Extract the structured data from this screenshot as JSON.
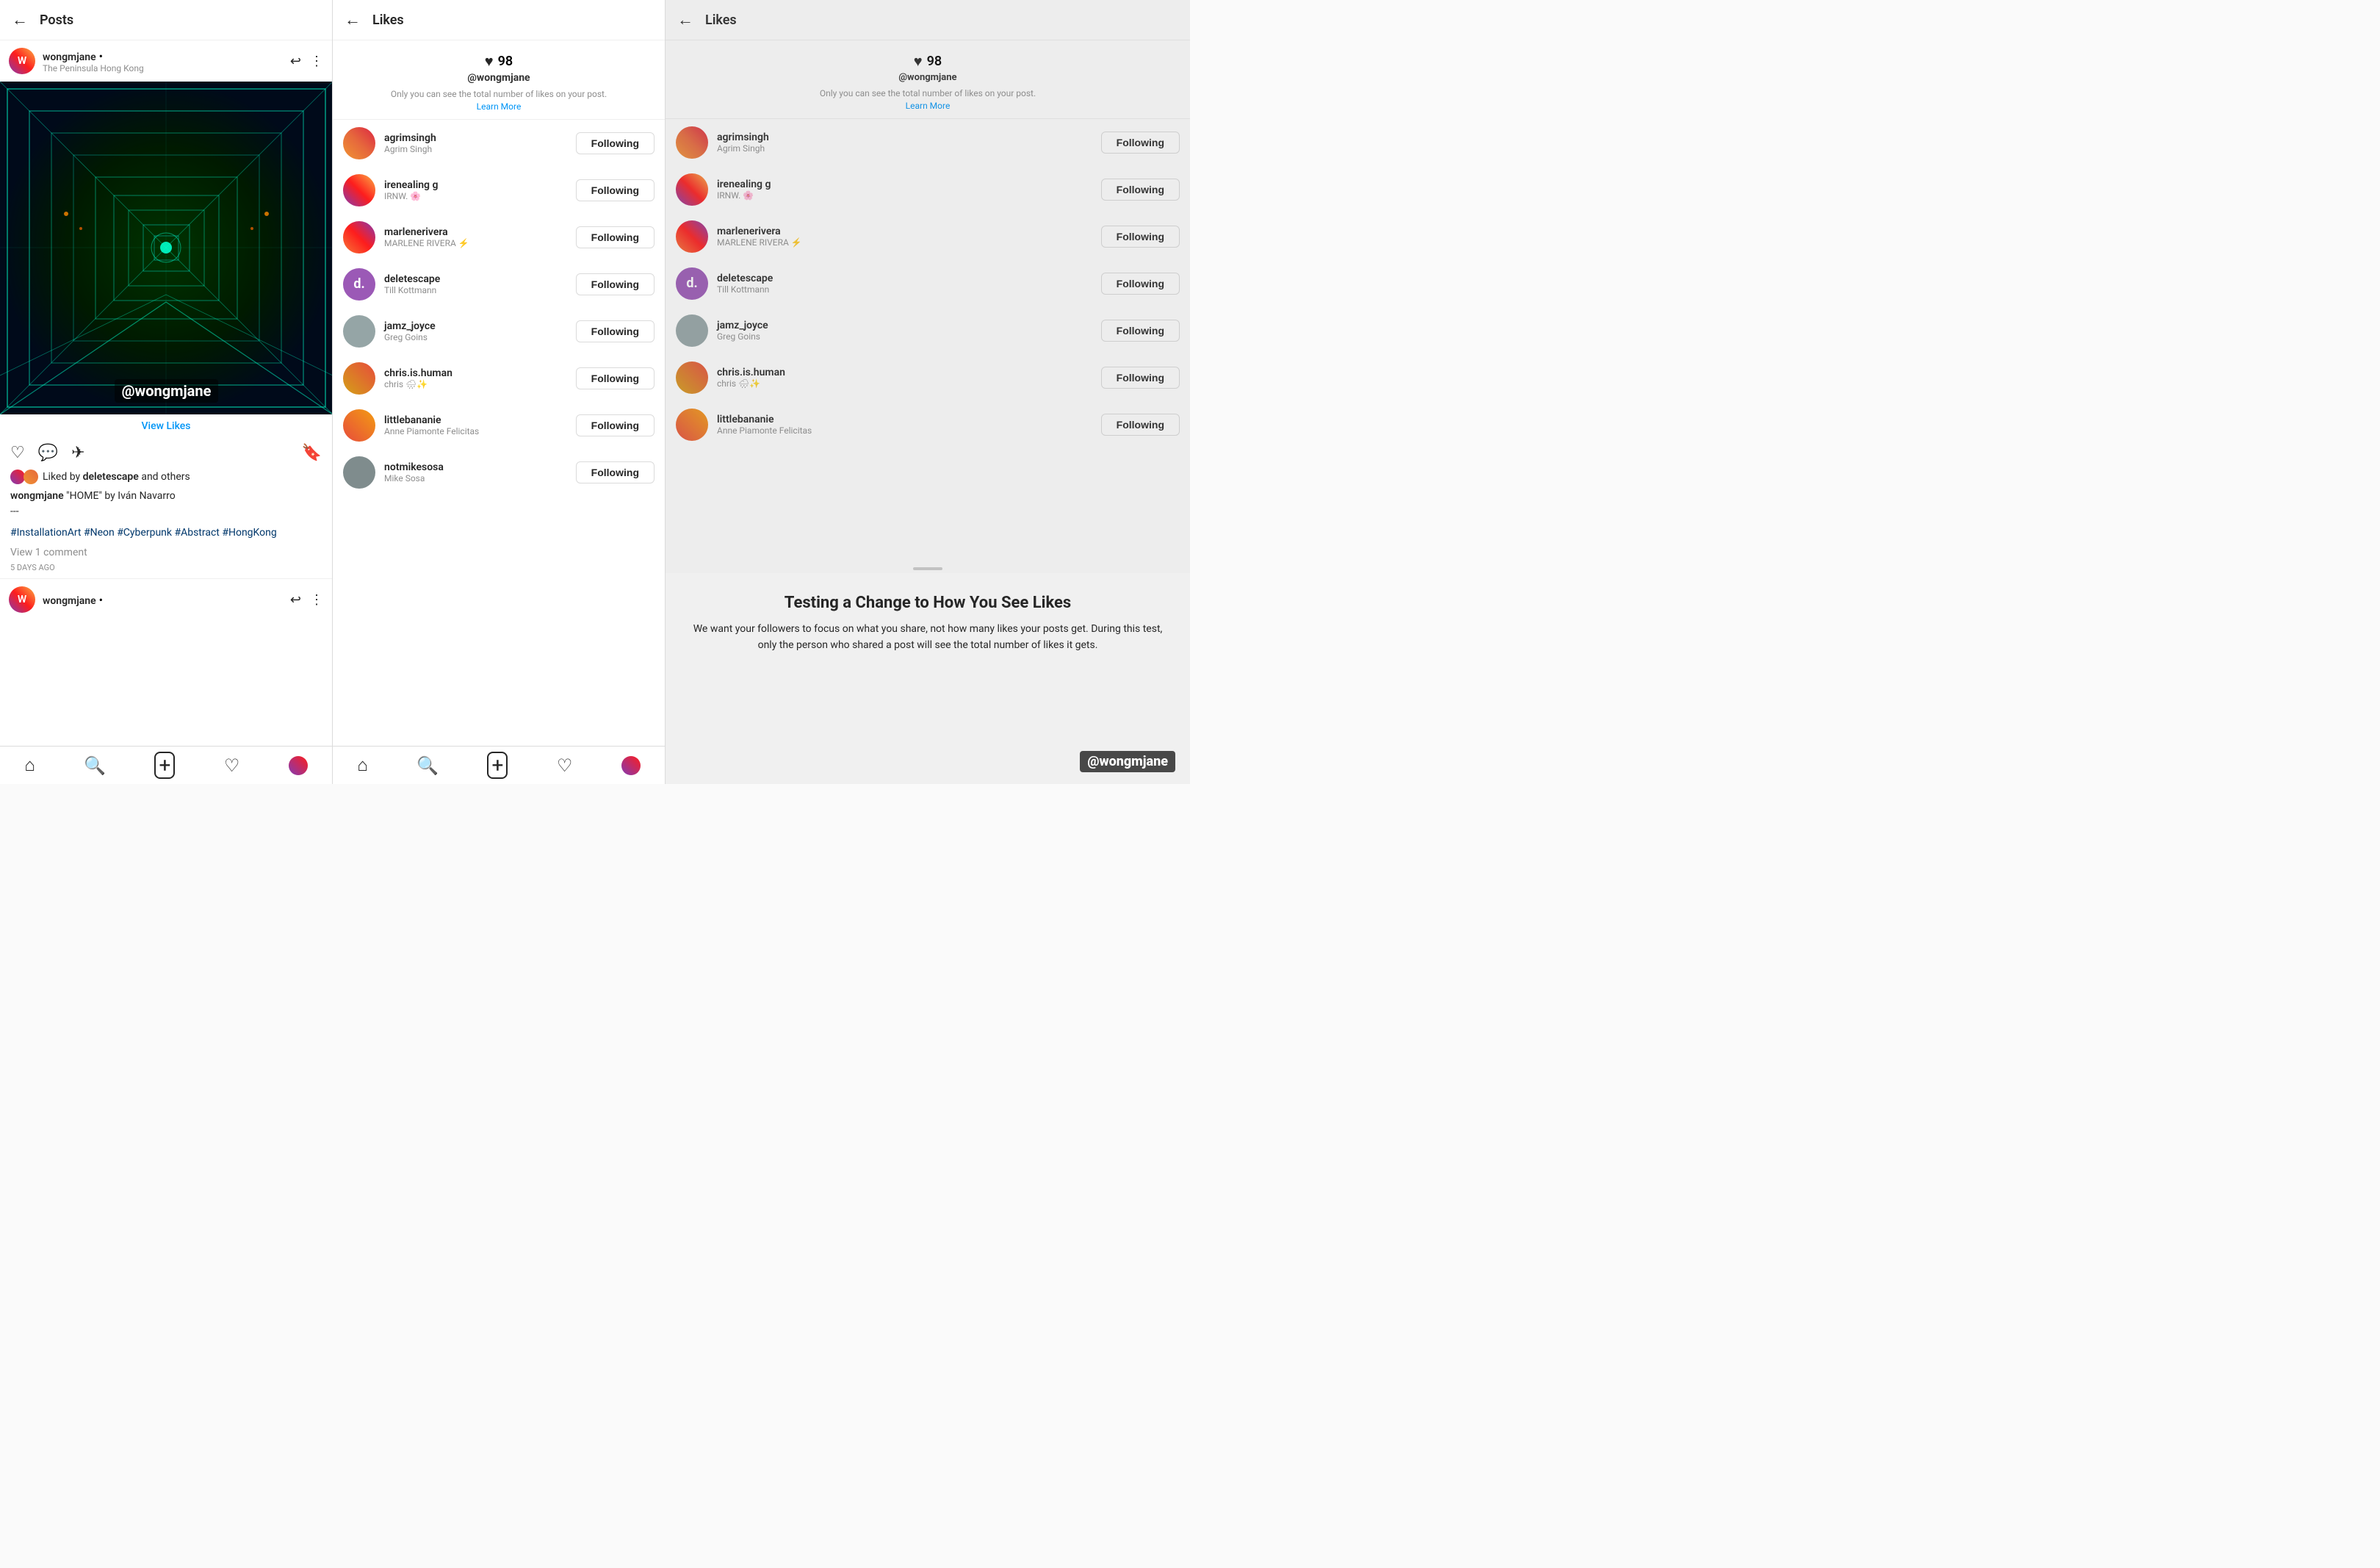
{
  "panel1": {
    "header": {
      "back_label": "←",
      "title": "Posts"
    },
    "post": {
      "username": "wongmjane",
      "dot": "•",
      "location": "The Peninsula Hong Kong",
      "watermark": "@wongmjane",
      "view_likes": "View Likes",
      "liked_by_prefix": "Liked by",
      "liked_by_user": "deletescape",
      "liked_by_suffix": "and others",
      "caption_user": "wongmjane",
      "caption_text": "\"HOME\" by Iván Navarro",
      "caption_dash": "---",
      "hashtags": "#InstallationArt #Neon #Cyberpunk #Abstract #HongKong",
      "comments": "View 1 comment",
      "time": "5 days ago"
    },
    "nav": {
      "home": "⌂",
      "search": "🔍",
      "add": "＋",
      "heart": "♡",
      "profile": "👤"
    }
  },
  "panel2": {
    "header": {
      "back_label": "←",
      "title": "Likes"
    },
    "likes_count": "98",
    "notice": "Only you can see the total number of likes on your post.",
    "learn_more": "Learn More",
    "watermark": "@wongmjane",
    "users": [
      {
        "handle": "agrimsingh",
        "fullname": "Agrim Singh",
        "button": "Following",
        "av_class": "av-agrim",
        "letter": ""
      },
      {
        "handle": "irenealing g",
        "fullname": "IRNW. 🌸",
        "button": "Following",
        "av_class": "av-irene",
        "letter": ""
      },
      {
        "handle": "marlenerivera",
        "fullname": "MARLENE RIVERA ⚡",
        "button": "Following",
        "av_class": "av-marlene",
        "letter": ""
      },
      {
        "handle": "deletescape",
        "fullname": "Till Kottmann",
        "button": "Following",
        "av_class": "av-delete",
        "letter": "d."
      },
      {
        "handle": "jamz_joyce",
        "fullname": "Greg Goins",
        "button": "Following",
        "av_class": "av-jamz",
        "letter": ""
      },
      {
        "handle": "chris.is.human",
        "fullname": "chris 🌧✨",
        "button": "Following",
        "av_class": "av-chris",
        "letter": ""
      },
      {
        "handle": "littlebananie",
        "fullname": "Anne Piamonte Felicitas",
        "button": "Following",
        "av_class": "av-little",
        "letter": ""
      },
      {
        "handle": "notmikesosa",
        "fullname": "Mike Sosa",
        "button": "Following",
        "av_class": "av-notmike",
        "letter": ""
      }
    ]
  },
  "panel3": {
    "header": {
      "back_label": "←",
      "title": "Likes"
    },
    "likes_count": "98",
    "notice": "Only you can see the total number of likes on your post.",
    "learn_more": "Learn More",
    "watermark": "@wongmjane",
    "users": [
      {
        "handle": "agrimsingh",
        "fullname": "Agrim Singh",
        "button": "Following",
        "av_class": "av-agrim"
      },
      {
        "handle": "irenealing g",
        "fullname": "IRNW. 🌸",
        "button": "Following",
        "av_class": "av-irene"
      },
      {
        "handle": "marlenerivera",
        "fullname": "MARLENE RIVERA ⚡",
        "button": "Following",
        "av_class": "av-marlene"
      },
      {
        "handle": "deletescape",
        "fullname": "Till Kottmann",
        "button": "Following",
        "av_class": "av-delete",
        "letter": "d."
      },
      {
        "handle": "jamz_joyce",
        "fullname": "Greg Goins",
        "button": "Following",
        "av_class": "av-jamz"
      },
      {
        "handle": "chris.is.human",
        "fullname": "chris 🌧✨",
        "button": "Following",
        "av_class": "av-chris"
      },
      {
        "handle": "littlebananie",
        "fullname": "Anne Piamonte Felicitas",
        "button": "Following",
        "av_class": "av-little"
      }
    ],
    "overlay": {
      "title": "Testing a Change to How You See Likes",
      "text": "We want your followers to focus on what you share, not how many likes your posts get. During this test, only the person who shared a post will see the total number of likes it gets.",
      "watermark": "@wongmjane"
    }
  }
}
